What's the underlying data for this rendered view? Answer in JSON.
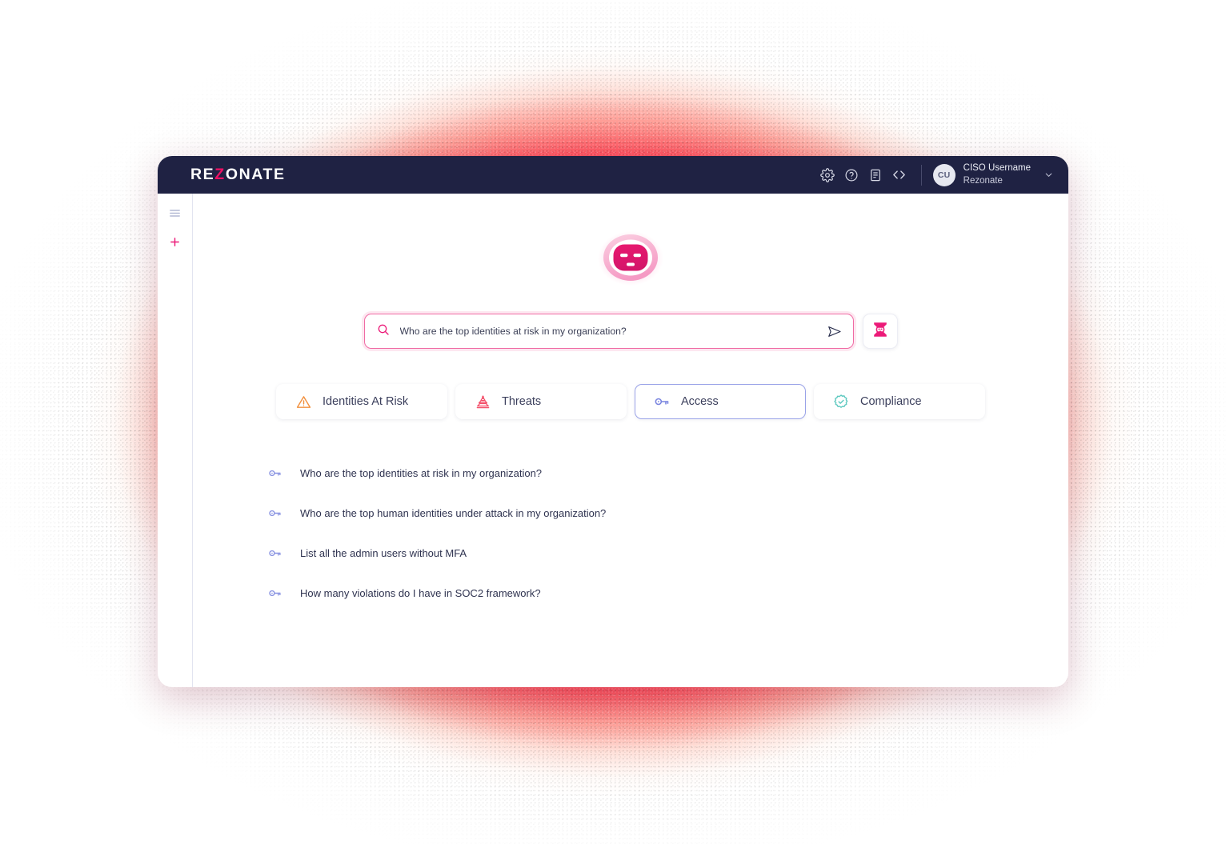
{
  "app": {
    "logo_prefix": "RE",
    "logo_accent": "Z",
    "logo_suffix": "ONATE",
    "accent_color": "#ed1164",
    "topbar_color": "#1f2243"
  },
  "topbar": {
    "icons": [
      {
        "name": "gear-icon",
        "label": "Settings"
      },
      {
        "name": "help-circle-icon",
        "label": "Help"
      },
      {
        "name": "document-icon",
        "label": "Docs"
      },
      {
        "name": "code-icon",
        "label": "API"
      }
    ],
    "user": {
      "initials": "CU",
      "name": "CISO Username",
      "org": "Rezonate",
      "chevron": "chevron-down-icon"
    }
  },
  "sidebar": {
    "items": [
      {
        "name": "menu-icon",
        "label": "Menu"
      },
      {
        "name": "plus-icon",
        "label": "New chat"
      }
    ]
  },
  "hero": {
    "bot_icon": "bot-avatar-icon"
  },
  "search": {
    "value": "Who are the top identities at risk in my organization?",
    "placeholder": "Who are the top identities at risk in my organization?",
    "search_icon": "search-icon",
    "send_icon": "send-icon",
    "assistant_button_icon": "bot-icon"
  },
  "tabs": [
    {
      "label": "Identities At Risk",
      "icon": "warning-triangle-icon",
      "color": "#f28b3c",
      "selected": false
    },
    {
      "label": "Threats",
      "icon": "threat-bug-icon",
      "color": "#f4516b",
      "selected": false
    },
    {
      "label": "Access",
      "icon": "key-icon",
      "color": "#7b86e0",
      "selected": true
    },
    {
      "label": "Compliance",
      "icon": "badge-check-icon",
      "color": "#5fc9c0",
      "selected": false
    }
  ],
  "suggestions": [
    {
      "icon": "key-icon",
      "label": "Who are the top identities at risk in my organization?"
    },
    {
      "icon": "key-icon",
      "label": "Who are the top human identities under attack in my organization?"
    },
    {
      "icon": "key-icon",
      "label": "List all the admin users without MFA"
    },
    {
      "icon": "key-icon",
      "label": "How many violations do I have in SOC2 framework?"
    }
  ]
}
